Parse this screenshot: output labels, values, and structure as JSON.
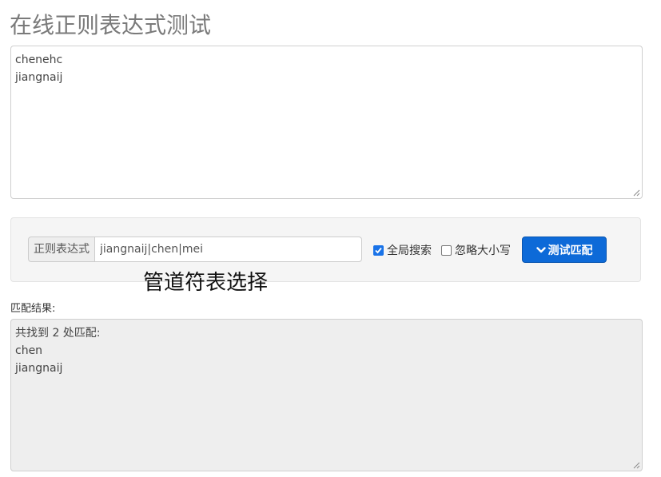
{
  "page": {
    "title": "在线正则表达式测试"
  },
  "source": {
    "text": "chenehc\njiangnaij"
  },
  "form": {
    "regex_label": "正则表达式",
    "regex_value": "jiangnaij|chen|mei",
    "global_label": "全局搜索",
    "global_checked": true,
    "ignore_case_label": "忽略大小写",
    "ignore_case_checked": false,
    "test_button_label": "测试匹配",
    "test_button_icon": "chevron-down-icon",
    "accent_color": "#0d6ad8"
  },
  "annotation": {
    "text": "管道符表选择"
  },
  "result": {
    "label": "匹配结果:",
    "text": "共找到 2 处匹配:\nchen\njiangnaij"
  }
}
